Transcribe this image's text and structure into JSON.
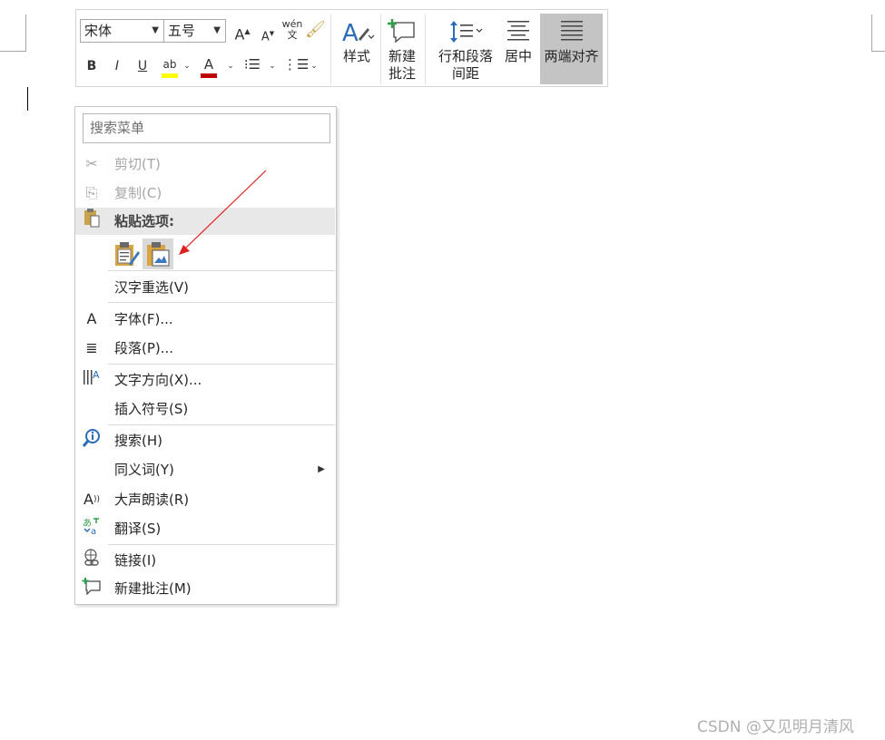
{
  "toolbar": {
    "font_name": "宋体",
    "font_size": "五号",
    "phonetic_glyph": "wén",
    "phonetic_char": "文",
    "bold": "B",
    "italic": "I",
    "underline": "U",
    "highlight": "ab",
    "font_color": "A",
    "styles_label": "样式",
    "new_comment_label_1": "新建",
    "new_comment_label_2": "批注",
    "line_spacing_label_1": "行和段落",
    "line_spacing_label_2": "间距",
    "center_label": "居中",
    "justify_label": "两端对齐"
  },
  "menu": {
    "search_placeholder": "搜索菜单",
    "cut": "剪切(T)",
    "copy": "复制(C)",
    "paste_options": "粘贴选项:",
    "hanzi_reselect": "汉字重选(V)",
    "font": "字体(F)...",
    "paragraph": "段落(P)...",
    "text_direction": "文字方向(X)...",
    "insert_symbol": "插入符号(S)",
    "search": "搜索(H)",
    "synonyms": "同义词(Y)",
    "read_aloud": "大声朗读(R)",
    "translate": "翻译(S)",
    "link": "链接(I)",
    "new_comment": "新建批注(M)"
  },
  "icons": {
    "cut": "scissors-icon",
    "copy": "copy-icon",
    "paste": "clipboard-icon",
    "font": "font-A-icon",
    "paragraph": "paragraph-icon",
    "text_direction": "text-direction-icon",
    "search": "search-info-icon",
    "read_aloud": "read-aloud-icon",
    "translate": "translate-icon",
    "link": "link-icon",
    "new_comment": "new-comment-icon"
  },
  "colors": {
    "accent_blue": "#2b6cb8",
    "highlight_yellow": "#ffff00",
    "font_red": "#c00000",
    "arrow_red": "#e02020",
    "selected_gray": "#c4c4c4"
  },
  "watermark": "CSDN @又见明月清风"
}
